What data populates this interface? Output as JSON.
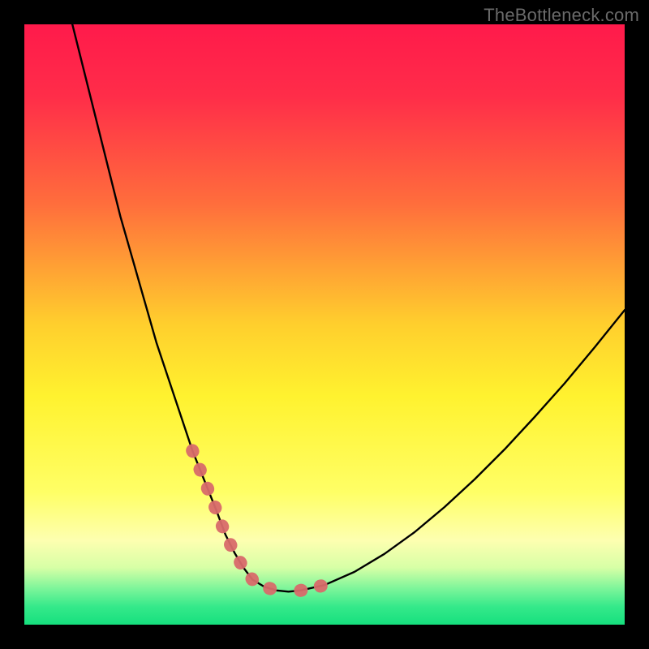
{
  "watermark": "TheBottleneck.com",
  "chart_data": {
    "type": "line",
    "title": "",
    "xlabel": "",
    "ylabel": "",
    "xlim": [
      0,
      100
    ],
    "ylim": [
      0,
      100
    ],
    "background_gradient": {
      "stops": [
        {
          "pos": 0.0,
          "color": "#ff1a4b"
        },
        {
          "pos": 0.12,
          "color": "#ff2d49"
        },
        {
          "pos": 0.3,
          "color": "#ff6e3c"
        },
        {
          "pos": 0.5,
          "color": "#ffcf2d"
        },
        {
          "pos": 0.62,
          "color": "#fff22f"
        },
        {
          "pos": 0.78,
          "color": "#ffff66"
        },
        {
          "pos": 0.86,
          "color": "#fdffb0"
        },
        {
          "pos": 0.905,
          "color": "#d7ffa6"
        },
        {
          "pos": 0.94,
          "color": "#7cf59a"
        },
        {
          "pos": 0.97,
          "color": "#35e98a"
        },
        {
          "pos": 1.0,
          "color": "#16e07e"
        }
      ]
    },
    "series": [
      {
        "name": "bottleneck-curve",
        "x": [
          8,
          10,
          12,
          14,
          16,
          18,
          20,
          22,
          24,
          26,
          28,
          30,
          32,
          33.5,
          35,
          36.5,
          38,
          40,
          42,
          44,
          46,
          50,
          55,
          60,
          65,
          70,
          75,
          80,
          85,
          90,
          95,
          100
        ],
        "y": [
          100,
          92,
          84,
          76,
          68,
          61,
          54,
          47,
          41,
          35,
          29,
          24,
          19,
          15,
          12,
          9.5,
          7.5,
          6.3,
          5.7,
          5.5,
          5.7,
          6.6,
          8.8,
          11.8,
          15.4,
          19.6,
          24.2,
          29.2,
          34.6,
          40.2,
          46.2,
          52.4
        ]
      }
    ],
    "highlight_segments": [
      {
        "name": "left-highlight",
        "color": "#d86a6a",
        "x": [
          28,
          30,
          32,
          33.5,
          35,
          36.5,
          38,
          40,
          42,
          44
        ],
        "y": [
          29,
          24,
          19,
          15,
          12,
          9.5,
          7.5,
          6.3,
          5.7,
          5.5
        ]
      },
      {
        "name": "right-highlight",
        "color": "#d86a6a",
        "x": [
          46,
          48,
          50,
          52
        ],
        "y": [
          5.7,
          6.1,
          6.6,
          7.4
        ]
      }
    ]
  }
}
